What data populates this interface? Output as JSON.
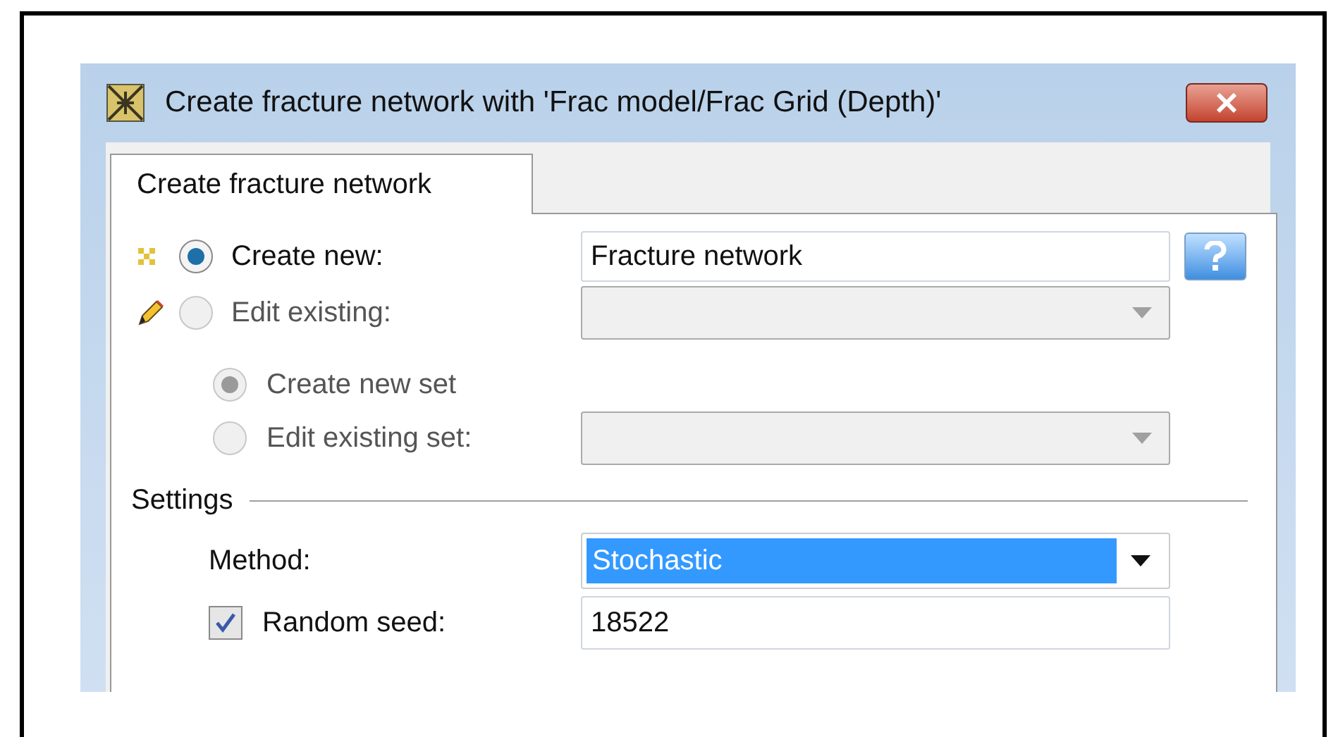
{
  "window": {
    "title": "Create fracture network with 'Frac model/Frac Grid (Depth)'"
  },
  "tabs": [
    {
      "label": "Create fracture network",
      "selected": true
    }
  ],
  "options": [
    {
      "kind": "text",
      "label": "Create new:",
      "selected": true,
      "disabled": false,
      "value": "Fracture network"
    },
    {
      "kind": "dropdown",
      "label": "Edit existing:",
      "selected": false,
      "disabled": true
    }
  ],
  "set_options": [
    {
      "kind": "none",
      "label": "Create new set",
      "selected": true,
      "disabled": true
    },
    {
      "kind": "dropdown",
      "label": "Edit existing set:",
      "selected": false,
      "disabled": true
    }
  ],
  "settings": {
    "title": "Settings",
    "method": {
      "label": "Method:",
      "value": "Stochastic"
    },
    "random_seed": {
      "label": "Random seed:",
      "checked": true,
      "value": "18522"
    }
  }
}
